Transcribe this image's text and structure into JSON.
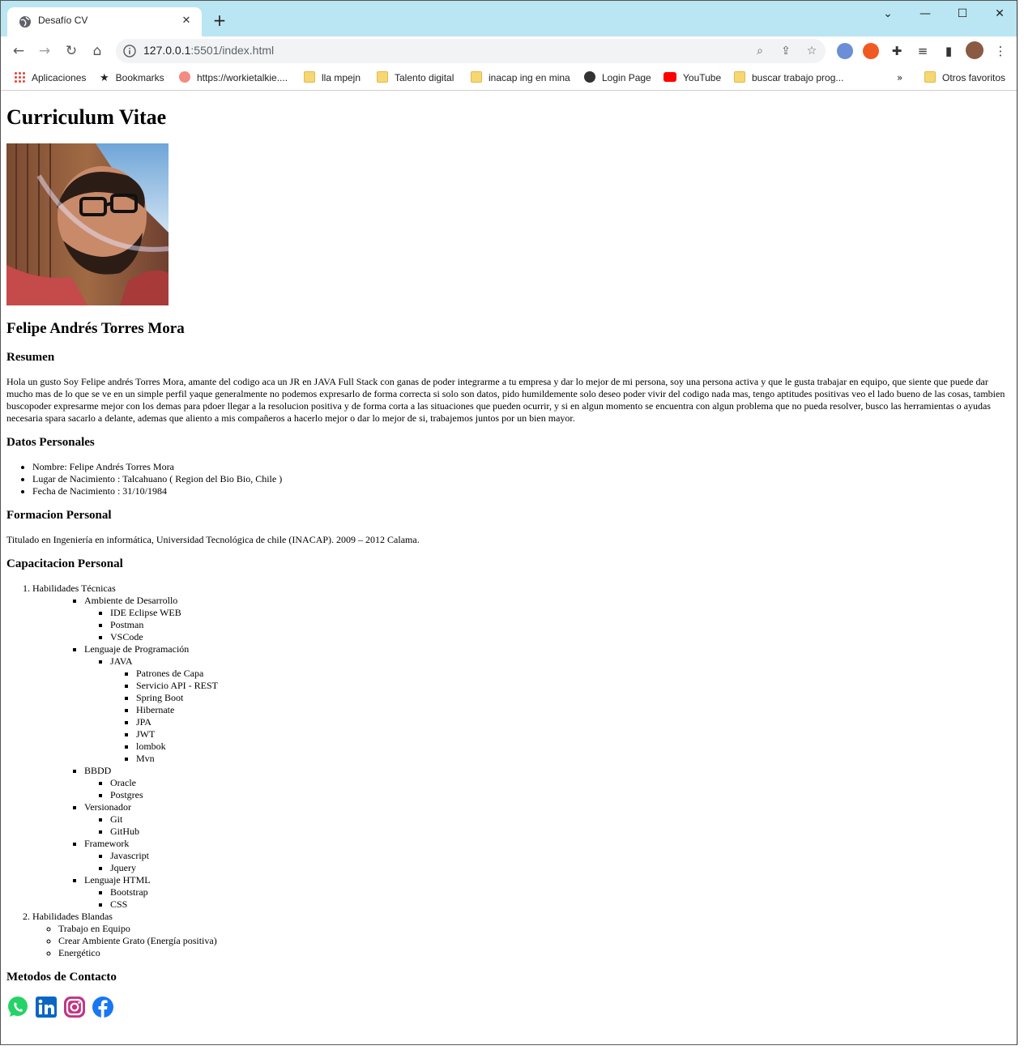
{
  "browser": {
    "tab_title": "Desafío CV",
    "url_host": "127.0.0.1",
    "url_rest": ":5501/index.html",
    "bookmarks": [
      "Aplicaciones",
      "Bookmarks",
      "https://workietalkie....",
      "lla mpejn",
      "Talento digital",
      "inacap ing en mina",
      "Login Page",
      "YouTube",
      "buscar trabajo prog...",
      "Otros favoritos"
    ]
  },
  "page": {
    "title": "Curriculum Vitae",
    "name": "Felipe Andrés Torres Mora",
    "resumen_heading": "Resumen",
    "resumen_text": "Hola un gusto Soy Felipe andrés Torres Mora, amante del codigo aca un JR en JAVA Full Stack con ganas de poder integrarme a tu empresa y dar lo mejor de mi persona, soy una persona activa y que le gusta trabajar en equipo, que siente que puede dar mucho mas de lo que se ve en un simple perfil yaque generalmente no podemos expresarlo de forma correcta si solo son datos, pido humildemente solo deseo poder vivir del codigo nada mas, tengo aptitudes positivas veo el lado bueno de las cosas, tambien buscopoder expresarme mejor con los demas para pdoer llegar a la resolucion positiva y de forma corta a las situaciones que pueden ocurrir, y si en algun momento se encuentra con algun problema que no pueda resolver, busco las herramientas o ayudas necesaria spara sacarlo a delante, ademas que aliento a mis compañeros a hacerlo mejor o dar lo mejor de si, trabajemos juntos por un bien mayor.",
    "datos_heading": "Datos Personales",
    "datos": [
      "Nombre: Felipe Andrés Torres Mora",
      "Lugar de Nacimiento : Talcahuano ( Region del Bio Bio, Chile )",
      "Fecha de Nacimiento : 31/10/1984"
    ],
    "formacion_heading": "Formacion Personal",
    "formacion_text": "Titulado en Ingeniería en informática, Universidad Tecnológica de chile (INACAP). 2009 – 2012 Calama.",
    "capacitacion_heading": "Capacitacion Personal",
    "tecnicas": {
      "label": "Habilidades Técnicas",
      "ambiente": {
        "label": "Ambiente de Desarrollo",
        "items": [
          "IDE Eclipse WEB",
          "Postman",
          "VSCode"
        ]
      },
      "lenguaje": {
        "label": "Lenguaje de Programación",
        "java": {
          "label": "JAVA",
          "items": [
            "Patrones de Capa",
            "Servicio API - REST",
            "Spring Boot",
            "Hibernate",
            "JPA",
            "JWT",
            "lombok",
            "Mvn"
          ]
        }
      },
      "bbdd": {
        "label": "BBDD",
        "items": [
          "Oracle",
          "Postgres"
        ]
      },
      "versionador": {
        "label": "Versionador",
        "items": [
          "Git",
          "GitHub"
        ]
      },
      "framework": {
        "label": "Framework",
        "items": [
          "Javascript",
          "Jquery"
        ]
      },
      "html": {
        "label": "Lenguaje HTML",
        "items": [
          "Bootstrap",
          "CSS"
        ]
      }
    },
    "blandas": {
      "label": "Habilidades Blandas",
      "items": [
        "Trabajo en Equipo",
        "Crear Ambiente Grato (Energía positiva)",
        "Energético"
      ]
    },
    "contacto_heading": "Metodos de Contacto",
    "contact_icons": [
      "whatsapp-icon",
      "linkedin-icon",
      "instagram-icon",
      "facebook-icon"
    ]
  },
  "colors": {
    "tabstrip": "#b9e6f2",
    "whatsapp": "#25d366",
    "linkedin": "#0a66c2",
    "instagram": "#c13584",
    "facebook": "#1877f2"
  }
}
